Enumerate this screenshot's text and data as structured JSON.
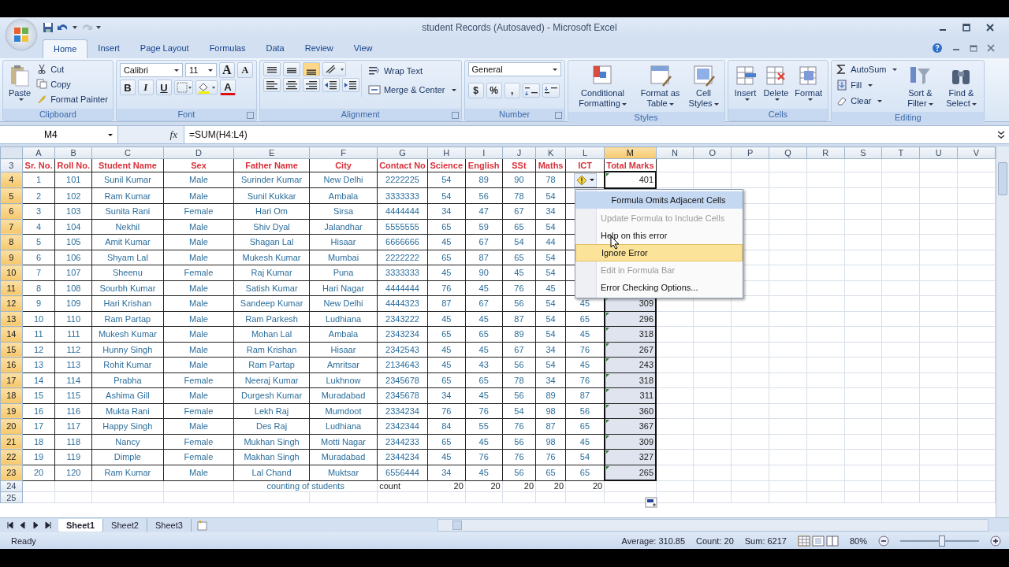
{
  "window": {
    "title": "student Records (Autosaved) - Microsoft Excel"
  },
  "ribbon_tabs": [
    {
      "label": "Home",
      "selected": true
    },
    {
      "label": "Insert",
      "selected": false
    },
    {
      "label": "Page Layout",
      "selected": false
    },
    {
      "label": "Formulas",
      "selected": false
    },
    {
      "label": "Data",
      "selected": false
    },
    {
      "label": "Review",
      "selected": false
    },
    {
      "label": "View",
      "selected": false
    }
  ],
  "ribbon": {
    "clipboard": {
      "title": "Clipboard",
      "paste": "Paste",
      "items": [
        "Cut",
        "Copy",
        "Format Painter"
      ]
    },
    "font": {
      "title": "Font",
      "family": "Calibri",
      "size": "11",
      "size_buttons": [
        "A",
        "A"
      ],
      "styles": [
        "B",
        "I",
        "U"
      ],
      "color_button": "A"
    },
    "alignment": {
      "title": "Alignment",
      "wrap": "Wrap Text",
      "merge": "Merge & Center"
    },
    "number": {
      "title": "Number",
      "format": "General",
      "symbols": [
        "$",
        "%",
        ","
      ]
    },
    "styles": {
      "title": "Styles",
      "buttons": [
        "Conditional Formatting",
        "Format as Table",
        "Cell Styles"
      ]
    },
    "cells": {
      "title": "Cells",
      "buttons": [
        "Insert",
        "Delete",
        "Format"
      ]
    },
    "editing": {
      "title": "Editing",
      "small": [
        "AutoSum",
        "Fill",
        "Clear"
      ],
      "large": [
        "Sort & Filter",
        "Find & Select"
      ]
    }
  },
  "formula_bar": {
    "name_box": "M4",
    "function_label": "fx",
    "formula": "=SUM(H4:L4)"
  },
  "sheet": {
    "columns": [
      {
        "label": "A",
        "selected": false
      },
      {
        "label": "B",
        "selected": false
      },
      {
        "label": "C",
        "selected": false
      },
      {
        "label": "D",
        "selected": false
      },
      {
        "label": "E",
        "selected": false
      },
      {
        "label": "F",
        "selected": false
      },
      {
        "label": "G",
        "selected": false
      },
      {
        "label": "H",
        "selected": false
      },
      {
        "label": "I",
        "selected": false
      },
      {
        "label": "J",
        "selected": false
      },
      {
        "label": "K",
        "selected": false
      },
      {
        "label": "L",
        "selected": false
      },
      {
        "label": "M",
        "selected": true
      },
      {
        "label": "N",
        "selected": false
      },
      {
        "label": "O",
        "selected": false
      },
      {
        "label": "P",
        "selected": false
      },
      {
        "label": "Q",
        "selected": false
      },
      {
        "label": "R",
        "selected": false
      },
      {
        "label": "S",
        "selected": false
      },
      {
        "label": "T",
        "selected": false
      },
      {
        "label": "U",
        "selected": false
      },
      {
        "label": "V",
        "selected": false
      }
    ],
    "rows": [
      {
        "num": "3",
        "selected": false,
        "kind": "header",
        "cells": [
          "Sr. No.",
          "Roll No.",
          "Student Name",
          "Sex",
          "Father Name",
          "City",
          "Contact No",
          "Science",
          "English",
          "SSt",
          "Maths",
          "ICT",
          "Total Marks"
        ]
      },
      {
        "num": "4",
        "selected": true,
        "kind": "data",
        "cells": [
          "1",
          "101",
          "Sunil Kumar",
          "Male",
          "Surinder Kumar",
          "New Delhi",
          "2222225",
          "54",
          "89",
          "90",
          "78"
        ],
        "smart_tag": true,
        "total": "401"
      },
      {
        "num": "5",
        "selected": true,
        "kind": "data",
        "cells": [
          "2",
          "102",
          "Ram Kumar",
          "Male",
          "Sunil Kukkar",
          "Ambala",
          "3333333",
          "54",
          "56",
          "78",
          "54"
        ]
      },
      {
        "num": "6",
        "selected": true,
        "kind": "data",
        "cells": [
          "3",
          "103",
          "Sunita Rani",
          "Female",
          "Hari Om",
          "Sirsa",
          "4444444",
          "34",
          "47",
          "67",
          "34"
        ]
      },
      {
        "num": "7",
        "selected": true,
        "kind": "data",
        "cells": [
          "4",
          "104",
          "Nekhil",
          "Male",
          "Shiv Dyal",
          "Jalandhar",
          "5555555",
          "65",
          "59",
          "65",
          "54"
        ]
      },
      {
        "num": "8",
        "selected": true,
        "kind": "data",
        "cells": [
          "5",
          "105",
          "Amit Kumar",
          "Male",
          "Shagan Lal",
          "Hisaar",
          "6666666",
          "45",
          "67",
          "54",
          "44"
        ]
      },
      {
        "num": "9",
        "selected": true,
        "kind": "data",
        "cells": [
          "6",
          "106",
          "Shyam Lal",
          "Male",
          "Mukesh Kumar",
          "Mumbai",
          "2222222",
          "65",
          "87",
          "65",
          "54"
        ]
      },
      {
        "num": "10",
        "selected": true,
        "kind": "data",
        "cells": [
          "7",
          "107",
          "Sheenu",
          "Female",
          "Raj Kumar",
          "Puna",
          "3333333",
          "45",
          "90",
          "45",
          "54"
        ]
      },
      {
        "num": "11",
        "selected": true,
        "kind": "data",
        "cells": [
          "8",
          "108",
          "Sourbh Kumar",
          "Male",
          "Satish Kumar",
          "Hari Nagar",
          "4444444",
          "76",
          "45",
          "76",
          "45"
        ]
      },
      {
        "num": "12",
        "selected": true,
        "kind": "data",
        "cells": [
          "9",
          "109",
          "Hari Krishan",
          "Male",
          "Sandeep Kumar",
          "New Delhi",
          "4444323",
          "87",
          "67",
          "56",
          "54"
        ],
        "ict": "45",
        "total": "309"
      },
      {
        "num": "13",
        "selected": true,
        "kind": "data",
        "cells": [
          "10",
          "110",
          "Ram Partap",
          "Male",
          "Ram Parkesh",
          "Ludhiana",
          "2343222",
          "45",
          "45",
          "87",
          "54"
        ],
        "ict": "65",
        "total": "296"
      },
      {
        "num": "14",
        "selected": true,
        "kind": "data",
        "cells": [
          "11",
          "111",
          "Mukesh Kumar",
          "Male",
          "Mohan Lal",
          "Ambala",
          "2343234",
          "65",
          "65",
          "89",
          "54"
        ],
        "ict": "45",
        "total": "318"
      },
      {
        "num": "15",
        "selected": true,
        "kind": "data",
        "cells": [
          "12",
          "112",
          "Hunny Singh",
          "Male",
          "Ram Krishan",
          "Hisaar",
          "2342543",
          "45",
          "45",
          "67",
          "34"
        ],
        "ict": "76",
        "total": "267"
      },
      {
        "num": "16",
        "selected": true,
        "kind": "data",
        "cells": [
          "13",
          "113",
          "Rohit Kumar",
          "Male",
          "Ram Partap",
          "Amritsar",
          "2134643",
          "45",
          "43",
          "56",
          "54"
        ],
        "ict": "45",
        "total": "243"
      },
      {
        "num": "17",
        "selected": true,
        "kind": "data",
        "cells": [
          "14",
          "114",
          "Prabha",
          "Female",
          "Neeraj Kumar",
          "Lukhnow",
          "2345678",
          "65",
          "65",
          "78",
          "34"
        ],
        "ict": "76",
        "total": "318"
      },
      {
        "num": "18",
        "selected": true,
        "kind": "data",
        "cells": [
          "15",
          "115",
          "Ashima Gill",
          "Male",
          "Durgesh Kumar",
          "Muradabad",
          "2345678",
          "34",
          "45",
          "56",
          "89"
        ],
        "ict": "87",
        "total": "311"
      },
      {
        "num": "19",
        "selected": true,
        "kind": "data",
        "cells": [
          "16",
          "116",
          "Mukta Rani",
          "Female",
          "Lekh Raj",
          "Mumdoot",
          "2334234",
          "76",
          "76",
          "54",
          "98"
        ],
        "ict": "56",
        "total": "360"
      },
      {
        "num": "20",
        "selected": true,
        "kind": "data",
        "cells": [
          "17",
          "117",
          "Happy Singh",
          "Male",
          "Des Raj",
          "Ludhiana",
          "2342344",
          "84",
          "55",
          "76",
          "87"
        ],
        "ict": "65",
        "total": "367"
      },
      {
        "num": "21",
        "selected": true,
        "kind": "data",
        "cells": [
          "18",
          "118",
          "Nancy",
          "Female",
          "Mukhan Singh",
          "Motti Nagar",
          "2344233",
          "65",
          "45",
          "56",
          "98"
        ],
        "ict": "45",
        "total": "309"
      },
      {
        "num": "22",
        "selected": true,
        "kind": "data",
        "cells": [
          "19",
          "119",
          "Dimple",
          "Female",
          "Makhan Singh",
          "Muradabad",
          "2344234",
          "45",
          "76",
          "76",
          "76"
        ],
        "ict": "54",
        "total": "327"
      },
      {
        "num": "23",
        "selected": true,
        "kind": "data",
        "cells": [
          "20",
          "120",
          "Ram Kumar",
          "Male",
          "Lal Chand",
          "Muktsar",
          "6556444",
          "34",
          "45",
          "56",
          "65"
        ],
        "ict": "65",
        "total": "265"
      },
      {
        "num": "24",
        "selected": false,
        "kind": "summary",
        "label": "counting of students",
        "count_label": "count",
        "counts": [
          "20",
          "20",
          "20",
          "20",
          "20"
        ]
      },
      {
        "num": "25",
        "selected": false,
        "kind": "empty"
      }
    ]
  },
  "error_menu": [
    {
      "label": "Formula Omits Adjacent Cells",
      "kind": "title",
      "disabled": false,
      "selected": false
    },
    {
      "label": "Update Formula to Include Cells",
      "kind": "item",
      "disabled": true,
      "selected": false
    },
    {
      "label": "Help on this error",
      "kind": "item",
      "disabled": false,
      "selected": false
    },
    {
      "label": "Ignore Error",
      "kind": "item",
      "disabled": false,
      "selected": true
    },
    {
      "label": "Edit in Formula Bar",
      "kind": "item",
      "disabled": true,
      "selected": false
    },
    {
      "label": "Error Checking Options...",
      "kind": "item",
      "disabled": false,
      "selected": false
    }
  ],
  "sheet_tabs": [
    {
      "label": "Sheet1",
      "selected": true
    },
    {
      "label": "Sheet2",
      "selected": false
    },
    {
      "label": "Sheet3",
      "selected": false
    }
  ],
  "status_bar": {
    "mode": "Ready",
    "average": "Average: 310.85",
    "count": "Count: 20",
    "sum": "Sum: 6217",
    "zoom": "80%",
    "zoom_level": {
      "level": 0.52
    }
  }
}
